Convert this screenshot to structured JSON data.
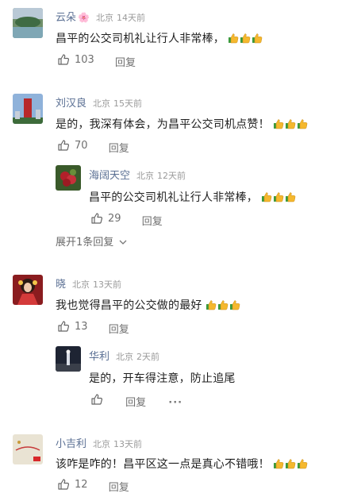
{
  "comments": [
    {
      "name": "云朵",
      "badge": "🌸",
      "location": "北京",
      "time": "14天前",
      "text": "昌平的公交司机礼让行人非常棒，",
      "emoji": "thumbs-up-icon",
      "likes": "103",
      "reply_label": "回复"
    },
    {
      "name": "刘汉良",
      "location": "北京",
      "time": "15天前",
      "text": "是的，我深有体会，为昌平公交司机点赞！",
      "emoji": "thumbs-up-icon",
      "likes": "70",
      "reply_label": "回复",
      "reply": {
        "name": "海阔天空",
        "location": "北京",
        "time": "12天前",
        "text": "昌平的公交司机礼让行人非常棒，",
        "likes": "29",
        "reply_label": "回复"
      },
      "expand_label": "展开1条回复"
    },
    {
      "name": "晓",
      "location": "北京",
      "time": "13天前",
      "text": "我也觉得昌平的公交做的最好",
      "emoji": "thumbs-up-icon",
      "likes": "13",
      "reply_label": "回复",
      "reply": {
        "name": "华利",
        "location": "北京",
        "time": "2天前",
        "text": "是的，开车得注意，防止追尾",
        "reply_label": "回复",
        "more_label": "···"
      }
    },
    {
      "name": "小吉利",
      "location": "北京",
      "time": "13天前",
      "text": "该咋是咋的！昌平区这一点是真心不错哦！",
      "emoji": "thumbs-up-icon",
      "likes": "12",
      "reply_label": "回复"
    }
  ],
  "colors": {
    "name": "#5a6f93",
    "meta": "#9a9a9a",
    "text": "#1f1f1f",
    "action": "#6f6f6f",
    "emoji": "#f5b82e"
  }
}
